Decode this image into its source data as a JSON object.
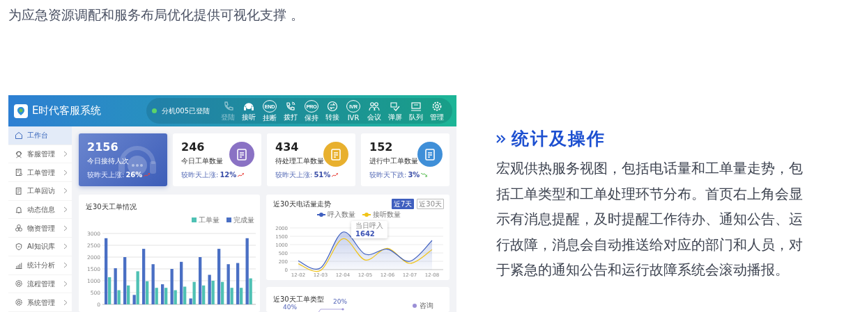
{
  "intro_text": "为应急资源调配和服务布局优化提供可视化支撑 。",
  "app": {
    "title": "E时代客服系统",
    "status": {
      "text": "分机005已登陆",
      "online": true
    },
    "toolbar": {
      "buttons": [
        {
          "label": "登陆",
          "disabled": true
        },
        {
          "label": "接听",
          "disabled": false
        },
        {
          "label": "挂断",
          "badge": "END",
          "disabled": false
        },
        {
          "label": "拨打",
          "disabled": false
        },
        {
          "label": "保持",
          "badge": "PRO",
          "disabled": false
        },
        {
          "label": "转接",
          "disabled": false
        },
        {
          "label": "IVR",
          "badge": "IVR",
          "disabled": false
        },
        {
          "label": "会议",
          "disabled": false
        },
        {
          "label": "弹屏",
          "disabled": false
        },
        {
          "label": "队列",
          "disabled": false
        },
        {
          "label": "管理",
          "disabled": false
        }
      ]
    },
    "sidebar": {
      "items": [
        {
          "label": "工作台",
          "selected": true,
          "expandable": false
        },
        {
          "label": "客服管理",
          "selected": false,
          "expandable": true
        },
        {
          "label": "工单管理",
          "selected": false,
          "expandable": true
        },
        {
          "label": "工单回访",
          "selected": false,
          "expandable": true
        },
        {
          "label": "动态信息",
          "selected": false,
          "expandable": true
        },
        {
          "label": "物资管理",
          "selected": false,
          "expandable": true
        },
        {
          "label": "AI知识库",
          "selected": false,
          "expandable": true
        },
        {
          "label": "统计分析",
          "selected": false,
          "expandable": true
        },
        {
          "label": "流程管理",
          "selected": false,
          "expandable": true
        },
        {
          "label": "系统管理",
          "selected": false,
          "expandable": true
        }
      ]
    },
    "stats": [
      {
        "kind": "banner",
        "value": "2156",
        "label": "今日接待人次",
        "compare": "较昨天上涨:",
        "change": "26%",
        "rising": true
      },
      {
        "kind": "icon",
        "value": "246",
        "label": "今日工单数量",
        "compare": "较昨天上涨:",
        "change": "12%",
        "rising": true,
        "color": "#8a72c4"
      },
      {
        "kind": "icon",
        "value": "434",
        "label": "待处理工单数量",
        "compare": "较昨天上涨:",
        "change": "51%",
        "rising": true,
        "color": "#e8b02e"
      },
      {
        "kind": "icon",
        "value": "152",
        "label": "进行中工单数量",
        "compare": "较昨天下跌:",
        "change": "3%",
        "rising": false,
        "color": "#3f8fd8"
      }
    ],
    "orders_chart": {
      "chart_data": {
        "type": "bar",
        "title": "近30天工单情况",
        "grid": true,
        "ylim": [
          0,
          3000
        ],
        "yticks": [
          0,
          500,
          1000,
          1500,
          2000,
          2500,
          3000
        ],
        "series": [
          {
            "name": "工单量",
            "color": "#4fc1b4",
            "values": [
              1150,
              600,
              800,
              1400,
              980,
              700,
              700,
              600,
              750,
              950,
              800,
              1000,
              950,
              700,
              700,
              1100
            ]
          },
          {
            "name": "完成量",
            "color": "#4a6fc4",
            "values": [
              2800,
              1530,
              2000,
              400,
              2350,
              1700,
              850,
              1500,
              1800,
              250,
              2000,
              1250,
              2350,
              1700,
              1750,
              2800
            ]
          }
        ]
      }
    },
    "calls_chart": {
      "ranges": [
        {
          "label": "近7天",
          "selected": true
        },
        {
          "label": "近30天",
          "selected": false
        }
      ],
      "tooltip": {
        "title": "当日呼入",
        "value": "1642"
      },
      "title": "近30天电话量走势",
      "legend": [
        {
          "label": "呼入数量",
          "color": "#3f5fbf"
        },
        {
          "label": "接听数量",
          "color": "#f0c419"
        }
      ],
      "y_axis_labels": [
        "2000",
        "1500",
        "1000",
        "500",
        "200",
        "0"
      ],
      "x_axis_labels": [
        "12-02",
        "12-03",
        "12-04",
        "12-05",
        "12-06",
        "12-07",
        "12-08"
      ]
    },
    "type_chart": {
      "title": "近30天工单类型",
      "labels": [
        "20%",
        "40%"
      ],
      "legend": [
        {
          "label": "咨询",
          "color": "#9b8fd6"
        }
      ]
    }
  },
  "feature": {
    "heading": "统计及操作",
    "text": "宏观供热服务视图，包括电话量和工单量走势，包括工单类型和工单处理环节分布。首页右上角会显示有消息提醒，及时提醒工作待办、通知公告、运行故障，消息会自动推送给对应的部门和人员，对于紧急的通知公告和运行故障系统会滚动播报。"
  }
}
